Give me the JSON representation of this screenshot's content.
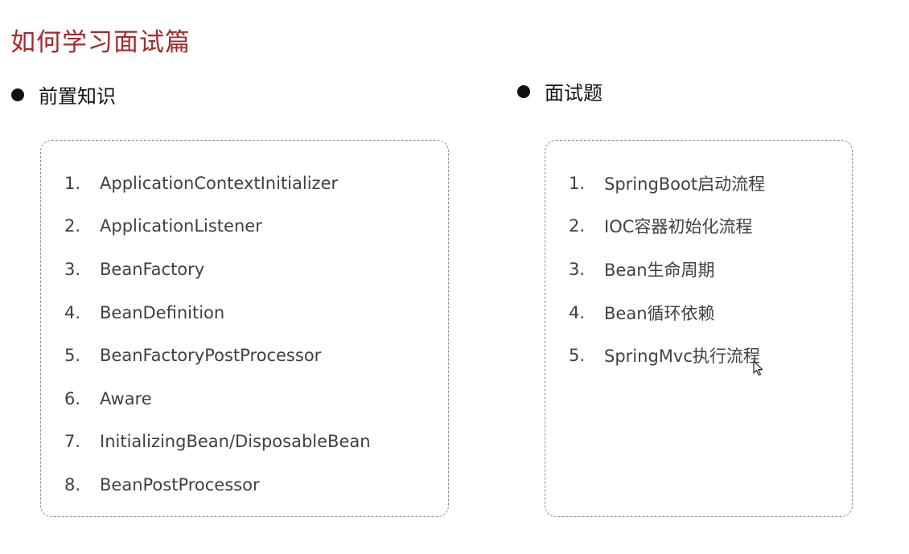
{
  "page": {
    "title": "如何学习面试篇"
  },
  "sections": [
    {
      "heading": "前置知识",
      "items": [
        {
          "num": "1.",
          "text": "ApplicationContextInitializer"
        },
        {
          "num": "2.",
          "text": "ApplicationListener"
        },
        {
          "num": "3.",
          "text": "BeanFactory"
        },
        {
          "num": "4.",
          "text": "BeanDefinition"
        },
        {
          "num": "5.",
          "text": "BeanFactoryPostProcessor"
        },
        {
          "num": "6.",
          "text": "Aware"
        },
        {
          "num": "7.",
          "text": "InitializingBean/DisposableBean"
        },
        {
          "num": "8.",
          "text": "BeanPostProcessor"
        }
      ]
    },
    {
      "heading": "面试题",
      "items": [
        {
          "num": "1.",
          "text": "SpringBoot启动流程"
        },
        {
          "num": "2.",
          "text": "IOC容器初始化流程"
        },
        {
          "num": "3.",
          "text": "Bean生命周期"
        },
        {
          "num": "4.",
          "text": "Bean循环依赖"
        },
        {
          "num": "5.",
          "text": "SpringMvc执行流程"
        }
      ]
    }
  ],
  "colors": {
    "title": "#a52a2a",
    "text": "#404040",
    "box_border": "#8c8c8c"
  },
  "icons": {
    "pointer": "mouse-pointer-icon"
  }
}
